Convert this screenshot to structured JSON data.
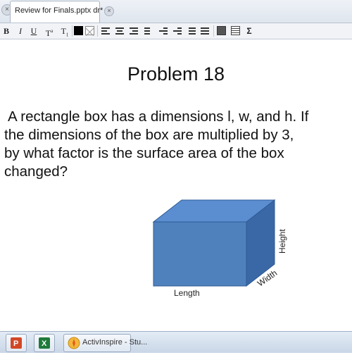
{
  "tabbar": {
    "tab_title": "Review for Finals.pptx dr*"
  },
  "toolbar": {
    "bold": "B",
    "italic": "I",
    "underline": "U",
    "superscript": "T",
    "superscript_mark": "a",
    "subscript": "T",
    "subscript_mark": "1",
    "sum_symbol": "Σ"
  },
  "slide": {
    "title": "Problem 18",
    "body_lines": [
      "A rectangle box has a dimensions l, w, and h. If",
      "the dimensions of the box are multiplied by 3,",
      "by what factor is the surface area of the box",
      "changed?"
    ],
    "figure": {
      "length_label": "Length",
      "width_label": "Width",
      "height_label": "Height",
      "front_color": "#4f81bd",
      "top_color": "#5b8ed0",
      "side_color": "#3a68a6"
    }
  },
  "taskbar": {
    "active_app_label": "ActivInspire - Stu..."
  }
}
